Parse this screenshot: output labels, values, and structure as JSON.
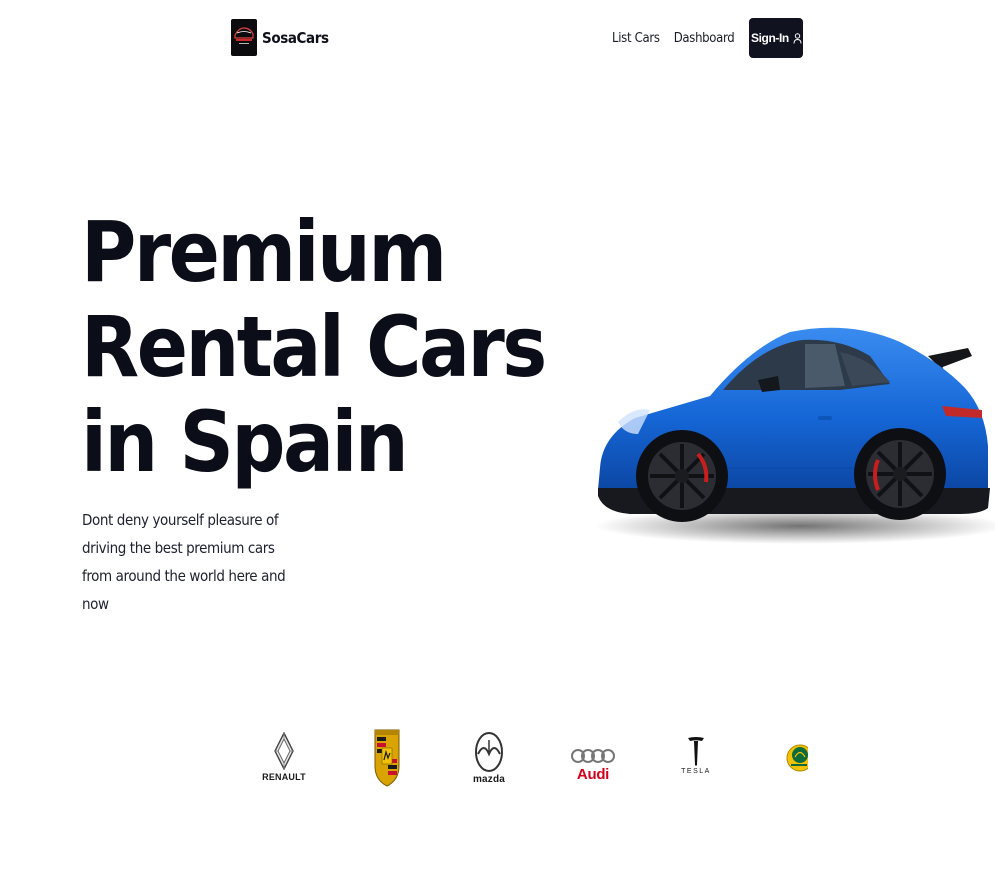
{
  "brand": {
    "name": "SosaCars",
    "logo_icon": "car-logo-icon"
  },
  "nav": {
    "links": [
      {
        "label": "List Cars"
      },
      {
        "label": "Dashboard"
      }
    ],
    "signin_label": "Sign-In",
    "signin_icon": "user-icon"
  },
  "hero": {
    "title_lines": [
      "Premium",
      "Rental Cars",
      "in Spain"
    ],
    "subtitle": "Dont deny yourself pleasure of driving the best premium cars from around the world here and now",
    "image": "blue-sports-car",
    "car_color": "#1566d6"
  },
  "brands": [
    {
      "name": "RENAULT",
      "icon": "renault-logo-icon"
    },
    {
      "name": "Porsche",
      "icon": "porsche-logo-icon"
    },
    {
      "name": "mazda",
      "icon": "mazda-logo-icon"
    },
    {
      "name": "Audi",
      "icon": "audi-logo-icon"
    },
    {
      "name": "TESLA",
      "icon": "tesla-logo-icon"
    },
    {
      "name": "LOTUS",
      "icon": "lotus-logo-icon"
    }
  ],
  "colors": {
    "primary_dark": "#10131f",
    "audi_red": "#d0021b",
    "lotus_yellow": "#f2c200",
    "lotus_green": "#0b6b3a"
  }
}
